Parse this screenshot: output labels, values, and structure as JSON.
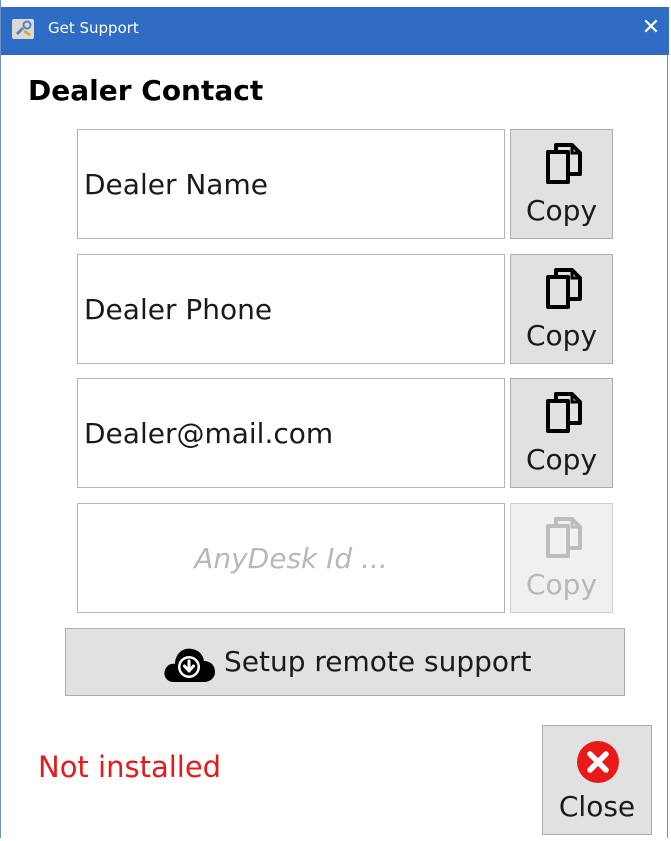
{
  "window": {
    "title": "Get Support",
    "titlebar_color": "#2f6cc4",
    "app_icon": "support-tools-icon",
    "close_icon": "close-x-icon",
    "close_glyph": "✕"
  },
  "heading": "Dealer Contact",
  "fields": [
    {
      "value": "Dealer Name",
      "placeholder": "",
      "copy_label": "Copy",
      "copy_enabled": true
    },
    {
      "value": "Dealer Phone",
      "placeholder": "",
      "copy_label": "Copy",
      "copy_enabled": true
    },
    {
      "value": "Dealer@mail.com",
      "placeholder": "",
      "copy_label": "Copy",
      "copy_enabled": true
    },
    {
      "value": "",
      "placeholder": "AnyDesk Id ...",
      "copy_label": "Copy",
      "copy_enabled": false
    }
  ],
  "setup_button": {
    "label": "Setup remote support",
    "icon": "cloud-download-icon"
  },
  "status": {
    "text": "Not installed",
    "color": "#e81919"
  },
  "close_button": {
    "label": "Close",
    "icon": "close-circle-icon",
    "icon_color": "#e81919"
  }
}
